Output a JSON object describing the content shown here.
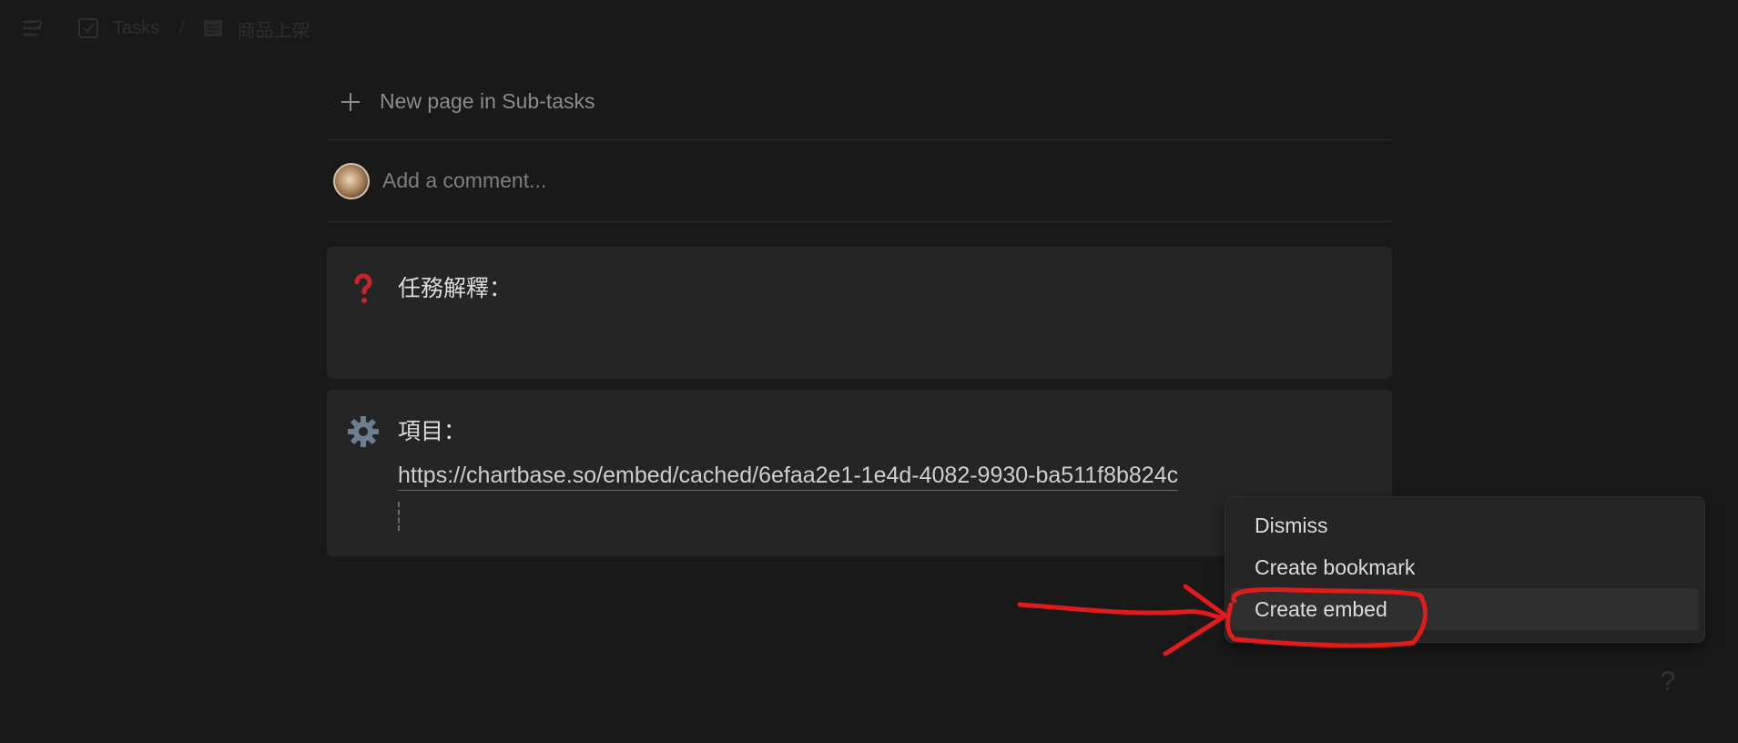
{
  "topbar": {
    "breadcrumb": [
      {
        "label": "Tasks",
        "icon": "checkbox-icon"
      },
      {
        "label": "商品上架",
        "icon": "page-icon"
      }
    ]
  },
  "subtasks": {
    "new_page_label": "New page in Sub-tasks"
  },
  "comment": {
    "placeholder": "Add a comment..."
  },
  "callouts": [
    {
      "icon": "question-mark-icon",
      "title": "任務解釋："
    },
    {
      "icon": "gear-icon",
      "title": "項目：",
      "link": "https://chartbase.so/embed/cached/6efaa2e1-1e4d-4082-9930-ba511f8b824c"
    }
  ],
  "paste_menu": {
    "items": [
      "Dismiss",
      "Create bookmark",
      "Create embed"
    ],
    "highlighted": "Create embed"
  },
  "help": {
    "label": "?"
  },
  "colors": {
    "background": "#191919",
    "callout_bg": "#252525",
    "annotation_red": "#e01b1b",
    "question_red": "#c8242f"
  }
}
